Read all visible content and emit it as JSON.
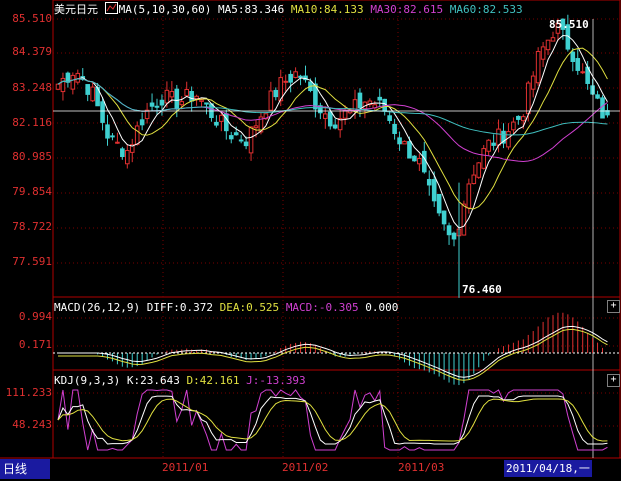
{
  "main": {
    "symbol": "美元日元",
    "ma_icon": "chart-line-icon",
    "ma_spec": "MA(5,10,30,60)",
    "ma5": "MA5:83.346",
    "ma10": "MA10:84.133",
    "ma30": "MA30:82.615",
    "ma60": "MA60:82.533",
    "yticks": [
      "85.510",
      "84.379",
      "83.248",
      "82.116",
      "80.985",
      "79.854",
      "78.722",
      "77.591"
    ],
    "high_label": "85.510",
    "low_label": "76.460"
  },
  "macd": {
    "spec": "MACD(26,12,9)",
    "diff": "DIFF:0.372",
    "dea": "DEA:0.525",
    "macd": "MACD:-0.305",
    "zero": "0.000",
    "yticks": [
      "0.994",
      "0.171"
    ]
  },
  "kdj": {
    "spec": "KDJ(9,3,3)",
    "k": "K:23.643",
    "d": "D:42.161",
    "j": "J:-13.393",
    "yticks": [
      "111.233",
      "48.243"
    ]
  },
  "xaxis": {
    "labels": [
      "2011/01",
      "2011/02",
      "2011/03"
    ]
  },
  "footer": {
    "period_tab": "日线",
    "cursor_date": "2011/04/18,一"
  },
  "controls": {
    "expand_symbol": "+"
  },
  "colors": {
    "up": "#e03030",
    "down": "#3fd0d0",
    "ma5": "#ffffff",
    "ma10": "#e0e040",
    "ma30": "#d040d0",
    "ma60": "#40c040",
    "axis": "#b00000",
    "label": "#e03030"
  }
}
